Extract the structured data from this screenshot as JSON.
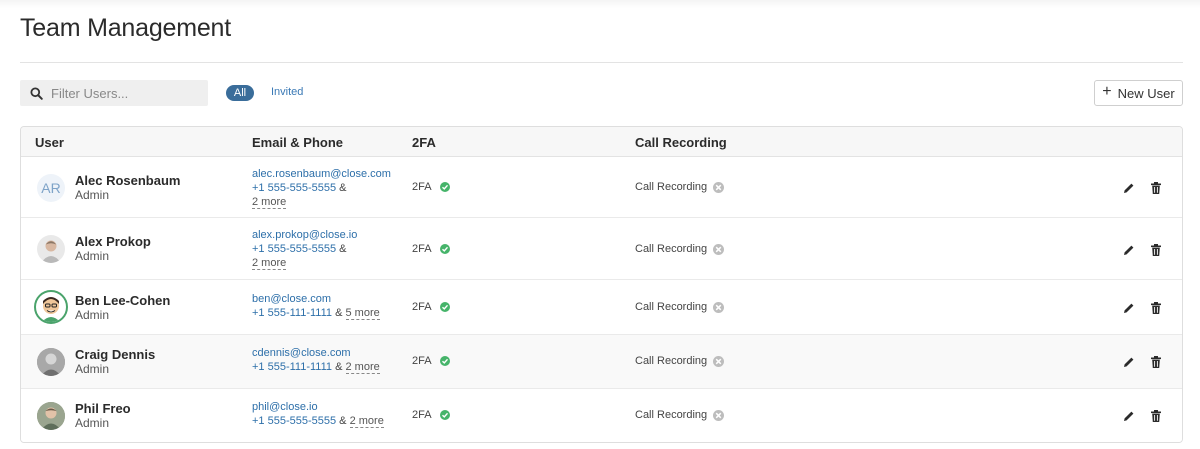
{
  "page": {
    "title": "Team Management"
  },
  "toolbar": {
    "search_placeholder": "Filter Users...",
    "filters": [
      "All",
      "Invited"
    ],
    "new_user_label": "New User"
  },
  "table": {
    "columns": [
      "User",
      "Email & Phone",
      "2FA",
      "Call Recording"
    ],
    "rows": [
      {
        "avatar": "AR",
        "name": "Alec Rosenbaum",
        "role": "Admin",
        "email": "alec.rosenbaum@close.com",
        "phone": "+1 555-555-5555",
        "amp": "&",
        "more": "2 more",
        "twofa": "2FA",
        "recording": "Call Recording"
      },
      {
        "avatar": "person-photo",
        "name": "Alex Prokop",
        "role": "Admin",
        "email": "alex.prokop@close.io",
        "phone": "+1 555-555-5555",
        "amp": "&",
        "more": "2 more",
        "twofa": "2FA",
        "recording": "Call Recording"
      },
      {
        "avatar": "cartoon-avatar",
        "name": "Ben Lee-Cohen",
        "role": "Admin",
        "email": "ben@close.com",
        "phone": "+1 555-111-1111",
        "amp": "&",
        "more": "5 more",
        "twofa": "2FA",
        "recording": "Call Recording"
      },
      {
        "avatar": "person-photo",
        "name": "Craig Dennis",
        "role": "Admin",
        "email": "cdennis@close.com",
        "phone": "+1 555-111-1111",
        "amp": "&",
        "more": "2 more",
        "twofa": "2FA",
        "recording": "Call Recording"
      },
      {
        "avatar": "person-photo",
        "name": "Phil Freo",
        "role": "Admin",
        "email": "phil@close.io",
        "phone": "+1 555-555-5555",
        "amp": "&",
        "more": "2 more",
        "twofa": "2FA",
        "recording": "Call Recording"
      }
    ]
  },
  "status": {
    "twofa_enabled_color": "#46b46a",
    "recording_disabled_color": "#bdbdbd",
    "accent": "#3a6d9a"
  },
  "icons": {
    "search": "search-icon",
    "edit": "pencil-icon",
    "delete": "trash-icon",
    "enabled": "check-circle-icon",
    "disabled": "x-circle-icon"
  }
}
